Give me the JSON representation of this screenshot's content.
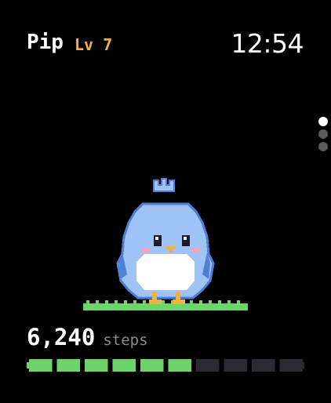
{
  "pet": {
    "name": "Pip",
    "level": "Lv 7"
  },
  "clock": {
    "time": "12:54"
  },
  "pager": {
    "total": 3,
    "active_index": 0
  },
  "steps": {
    "count": "6,240",
    "label": "steps"
  },
  "progress": {
    "total_segments": 10,
    "filled_segments": 6
  },
  "colors": {
    "background": "#000000",
    "level_text": "#f2b33d",
    "steps_label": "#8a8a8e",
    "progress_filled": "#6dd46a",
    "progress_empty": "#2a2a33",
    "dot_active": "#ffffff",
    "dot_inactive": "#5a5a5e",
    "pet_body": "#9fc3f5",
    "pet_outline": "#4f7fd8",
    "pet_belly": "#ffffff",
    "pet_cheek": "#f4a3c7",
    "pet_beak": "#f2b33d",
    "pet_eye": "#1a1a2e",
    "grass": "#6dd46a"
  },
  "icons": {
    "pet": "pixel-bird-pet",
    "ground": "grass-strip"
  }
}
